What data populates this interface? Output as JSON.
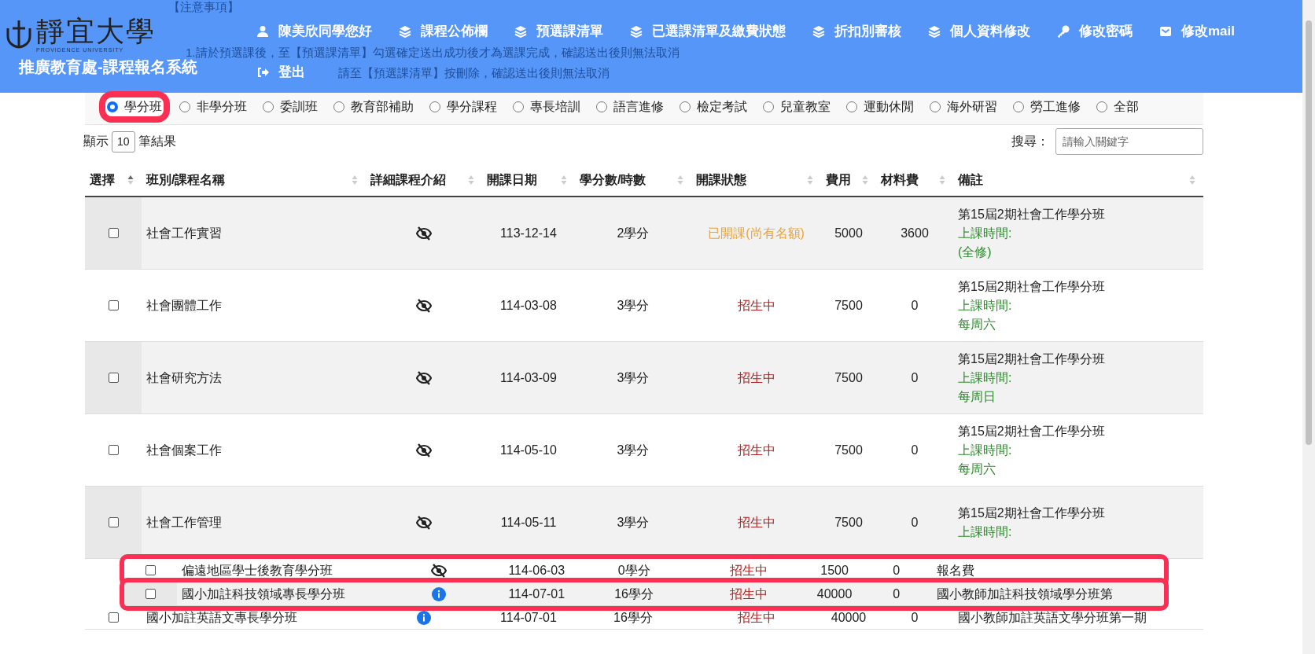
{
  "header": {
    "logo_text": "靜宜大學",
    "logo_subtext": "PROVIDENCE UNIVERSITY",
    "system_title": "推廣教育處-課程報名系統",
    "notice": [
      "【注意事項】",
      "1.請於預選課後，至【預選課清單】勾選確定送出成功後才為選課完成，確認送出後則無法取消",
      "請至【預選課清單】按刪除，確認送出後則無法取消"
    ],
    "nav": [
      "陳美欣同學您好",
      "課程公佈欄",
      "預選課清單",
      "已選課清單及繳費狀態",
      "折扣別審核",
      "個人資料修改",
      "修改密碼",
      "修改mail"
    ],
    "logout": "登出"
  },
  "categories": [
    {
      "label": "學分班",
      "selected": true,
      "highlighted": true
    },
    {
      "label": "非學分班",
      "selected": false,
      "highlighted": false
    },
    {
      "label": "委訓班",
      "selected": false,
      "highlighted": false
    },
    {
      "label": "教育部補助",
      "selected": false,
      "highlighted": false
    },
    {
      "label": "學分課程",
      "selected": false,
      "highlighted": false
    },
    {
      "label": "專長培訓",
      "selected": false,
      "highlighted": false
    },
    {
      "label": "語言進修",
      "selected": false,
      "highlighted": false
    },
    {
      "label": "檢定考試",
      "selected": false,
      "highlighted": false
    },
    {
      "label": "兒童教室",
      "selected": false,
      "highlighted": false
    },
    {
      "label": "運動休閒",
      "selected": false,
      "highlighted": false
    },
    {
      "label": "海外研習",
      "selected": false,
      "highlighted": false
    },
    {
      "label": "勞工進修",
      "selected": false,
      "highlighted": false
    },
    {
      "label": "全部",
      "selected": false,
      "highlighted": false
    }
  ],
  "length_control": {
    "prefix": "顯示",
    "value": "10",
    "suffix": "筆結果"
  },
  "search": {
    "label": "搜尋：",
    "placeholder": "請輸入關鍵字"
  },
  "table": {
    "columns": [
      "選擇",
      "班別/課程名稱",
      "詳細課程介紹",
      "開課日期",
      "學分數/時數",
      "開課狀態",
      "費用",
      "材料費",
      "備註"
    ],
    "rows": [
      {
        "checked": false,
        "highlighted": false,
        "kind": "hidden",
        "name": "社會工作實習",
        "date": "113-12-14",
        "credits": "2學分",
        "status": "已開課(尚有名額)",
        "color": "#e8a33d",
        "fee": "5000",
        "material_fee": "3600",
        "remarks": [
          {
            "text": "第15屆2期社會工作學分班",
            "kind": "plain"
          },
          {
            "text": "上課時間:",
            "kind": "schedule"
          },
          {
            "text": "(全修)",
            "kind": "schedule"
          }
        ]
      },
      {
        "checked": false,
        "highlighted": false,
        "kind": "hidden",
        "name": "社會團體工作",
        "date": "114-03-08",
        "credits": "3學分",
        "status": "招生中",
        "color": "#b22222",
        "fee": "7500",
        "material_fee": "0",
        "remarks": [
          {
            "text": "第15屆2期社會工作學分班",
            "kind": "plain"
          },
          {
            "text": "上課時間:",
            "kind": "schedule"
          },
          {
            "text": "每周六",
            "kind": "schedule"
          }
        ]
      },
      {
        "checked": false,
        "highlighted": false,
        "kind": "hidden",
        "name": "社會研究方法",
        "date": "114-03-09",
        "credits": "3學分",
        "status": "招生中",
        "color": "#b22222",
        "fee": "7500",
        "material_fee": "0",
        "remarks": [
          {
            "text": "第15屆2期社會工作學分班",
            "kind": "plain"
          },
          {
            "text": "上課時間:",
            "kind": "schedule"
          },
          {
            "text": "每周日",
            "kind": "schedule"
          }
        ]
      },
      {
        "checked": false,
        "highlighted": false,
        "kind": "hidden",
        "name": "社會個案工作",
        "date": "114-05-10",
        "credits": "3學分",
        "status": "招生中",
        "color": "#b22222",
        "fee": "7500",
        "material_fee": "0",
        "remarks": [
          {
            "text": "第15屆2期社會工作學分班",
            "kind": "plain"
          },
          {
            "text": "上課時間:",
            "kind": "schedule"
          },
          {
            "text": "每周六",
            "kind": "schedule"
          }
        ]
      },
      {
        "checked": false,
        "highlighted": false,
        "kind": "hidden",
        "name": "社會工作管理",
        "date": "114-05-11",
        "credits": "3學分",
        "status": "招生中",
        "color": "#b22222",
        "fee": "7500",
        "material_fee": "0",
        "remarks": [
          {
            "text": "第15屆2期社會工作學分班",
            "kind": "plain"
          },
          {
            "text": "上課時間:",
            "kind": "schedule"
          }
        ]
      },
      {
        "checked": false,
        "highlighted": true,
        "kind": "hidden",
        "name": "偏遠地區學士後教育學分班",
        "date": "114-06-03",
        "credits": "0學分",
        "status": "招生中",
        "color": "#b22222",
        "fee": "1500",
        "material_fee": "0",
        "remarks": [
          {
            "text": "報名費",
            "kind": "plain"
          }
        ]
      },
      {
        "checked": false,
        "highlighted": true,
        "kind": "info",
        "name": "國小加註科技領域專長學分班",
        "date": "114-07-01",
        "credits": "16學分",
        "status": "招生中",
        "color": "#b22222",
        "fee": "40000",
        "material_fee": "0",
        "remarks": [
          {
            "text": "國小教師加註科技領域學分班第",
            "kind": "plain"
          }
        ]
      },
      {
        "checked": false,
        "highlighted": false,
        "kind": "info",
        "name": "國小加註英語文專長學分班",
        "date": "114-07-01",
        "credits": "16學分",
        "status": "招生中",
        "color": "#b22222",
        "fee": "40000",
        "material_fee": "0",
        "remarks": [
          {
            "text": "國小教師加註英語文學分班第一期",
            "kind": "plain"
          }
        ]
      }
    ]
  }
}
